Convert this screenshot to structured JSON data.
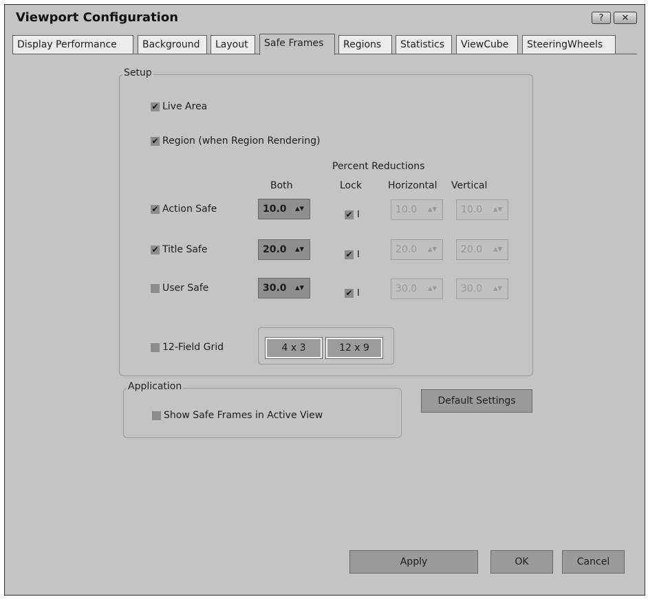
{
  "window": {
    "title": "Viewport Configuration",
    "help_label": "?",
    "close_label": "✕"
  },
  "tabs": [
    {
      "label": "Display Performance",
      "active": false
    },
    {
      "label": "Background",
      "active": false
    },
    {
      "label": "Layout",
      "active": false
    },
    {
      "label": "Safe Frames",
      "active": true
    },
    {
      "label": "Regions",
      "active": false
    },
    {
      "label": "Statistics",
      "active": false
    },
    {
      "label": "ViewCube",
      "active": false
    },
    {
      "label": "SteeringWheels",
      "active": false
    }
  ],
  "setup": {
    "group_label": "Setup",
    "live_area": {
      "label": "Live Area",
      "checked": true
    },
    "region": {
      "label": "Region (when Region Rendering)",
      "checked": true
    },
    "percent_reductions_label": "Percent Reductions",
    "columns": {
      "both": "Both",
      "lock": "Lock",
      "horizontal": "Horizontal",
      "vertical": "Vertical"
    },
    "rows": [
      {
        "label": "Action Safe",
        "checked": true,
        "both": "10.0",
        "lock": true,
        "lock_suffix": "I",
        "horizontal": "10.0",
        "vertical": "10.0"
      },
      {
        "label": "Title Safe",
        "checked": true,
        "both": "20.0",
        "lock": true,
        "lock_suffix": "I",
        "horizontal": "20.0",
        "vertical": "20.0"
      },
      {
        "label": "User Safe",
        "checked": false,
        "both": "30.0",
        "lock": true,
        "lock_suffix": "I",
        "horizontal": "30.0",
        "vertical": "30.0"
      }
    ],
    "field_grid": {
      "label": "12-Field Grid",
      "checked": false,
      "option_a": "4 x 3",
      "option_b": "12 x 9"
    }
  },
  "application": {
    "group_label": "Application",
    "show_safe_frames": {
      "label": "Show Safe Frames in Active View",
      "checked": false
    }
  },
  "buttons": {
    "default_settings": "Default Settings",
    "apply": "Apply",
    "ok": "OK",
    "cancel": "Cancel"
  },
  "icons": {
    "check": "✔",
    "spinner_arrows": "▴▾"
  },
  "colors": {
    "dialog_bg": "#c4c4c4",
    "tab_inactive_bg": "#ececec",
    "button_bg": "#9a9a9a"
  }
}
